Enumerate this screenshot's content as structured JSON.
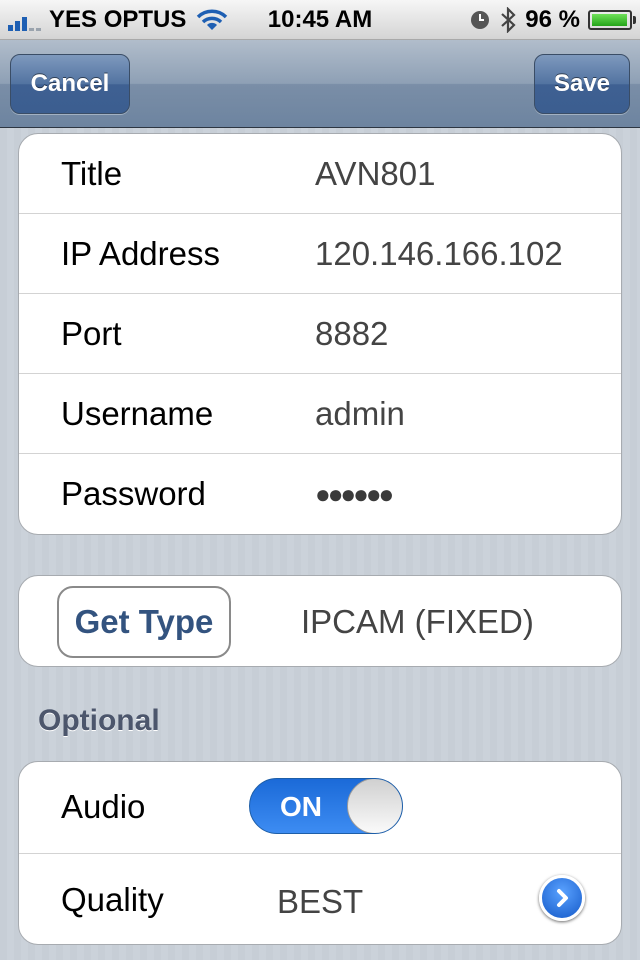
{
  "status_bar": {
    "carrier": "YES OPTUS",
    "time": "10:45 AM",
    "battery": "96 %"
  },
  "nav": {
    "cancel_label": "Cancel",
    "save_label": "Save"
  },
  "fields": [
    {
      "label": "Title",
      "value": "AVN801"
    },
    {
      "label": "IP Address",
      "value": "120.146.166.102"
    },
    {
      "label": "Port",
      "value": "8882"
    },
    {
      "label": "Username",
      "value": "admin"
    },
    {
      "label": "Password",
      "value": "●●●●●●"
    }
  ],
  "get_type": {
    "button_label": "Get Type",
    "value": "IPCAM (FIXED)"
  },
  "optional": {
    "header": "Optional",
    "audio_label": "Audio",
    "audio_toggle": "ON",
    "quality_label": "Quality",
    "quality_value": "BEST"
  },
  "colors": {
    "nav_button": "#3f6092",
    "toggle_on": "#1b6ad8",
    "section_header": "#4c566c",
    "get_type_text": "#33537f"
  },
  "icons": [
    "signal-icon",
    "wifi-icon",
    "clock-icon",
    "bluetooth-icon",
    "battery-icon",
    "disclosure-icon"
  ]
}
